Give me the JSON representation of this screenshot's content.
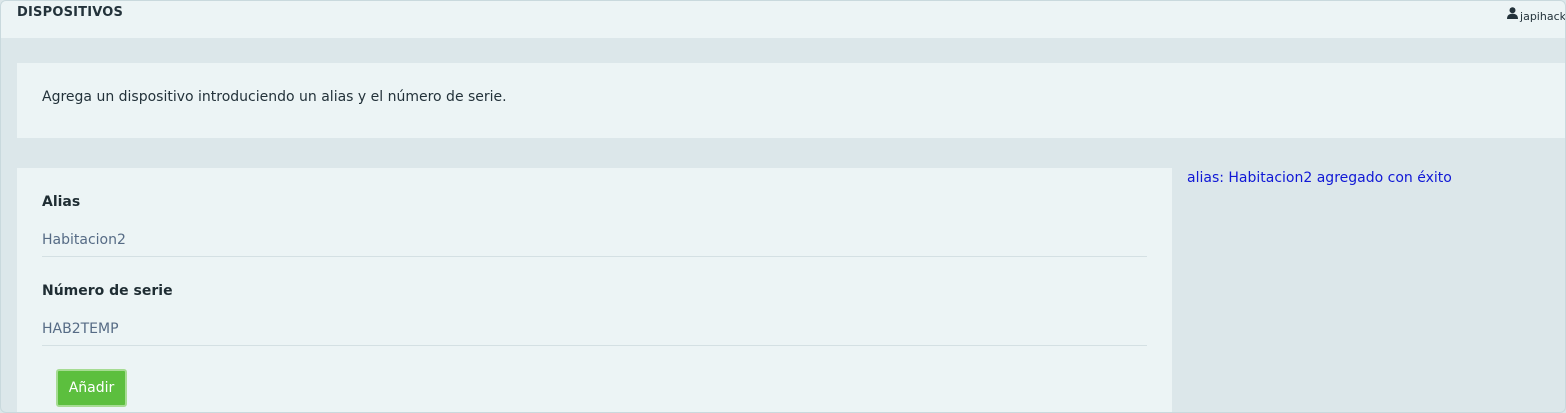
{
  "header": {
    "title": "DISPOSITIVOS",
    "user_name": "japihack",
    "user_icon": "user-icon"
  },
  "intro": {
    "text": "Agrega un dispositivo introduciendo un alias y el número de serie."
  },
  "form": {
    "alias": {
      "label": "Alias",
      "value": "Habitacion2"
    },
    "serial": {
      "label": "Número de serie",
      "value": "HAB2TEMP"
    },
    "submit_label": "Añadir"
  },
  "status": {
    "message": "alias: Habitacion2 agregado con éxito",
    "color": "#1018d6"
  },
  "colors": {
    "background": "#dce7ea",
    "card": "#ecf4f5",
    "button": "#5cbf3e"
  }
}
